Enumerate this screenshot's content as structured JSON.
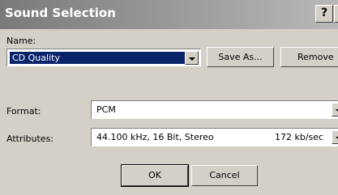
{
  "window": {
    "title": "Sound Selection",
    "help_label": "?"
  },
  "name": {
    "label": "Name:",
    "value": "CD Quality",
    "save_as_label": "Save As...",
    "remove_label": "Remove"
  },
  "format": {
    "label": "Format:",
    "value": "PCM"
  },
  "attributes": {
    "label": "Attributes:",
    "value": "44.100 kHz, 16 Bit, Stereo",
    "rate": "172 kb/sec"
  },
  "buttons": {
    "ok": "OK",
    "cancel": "Cancel"
  }
}
